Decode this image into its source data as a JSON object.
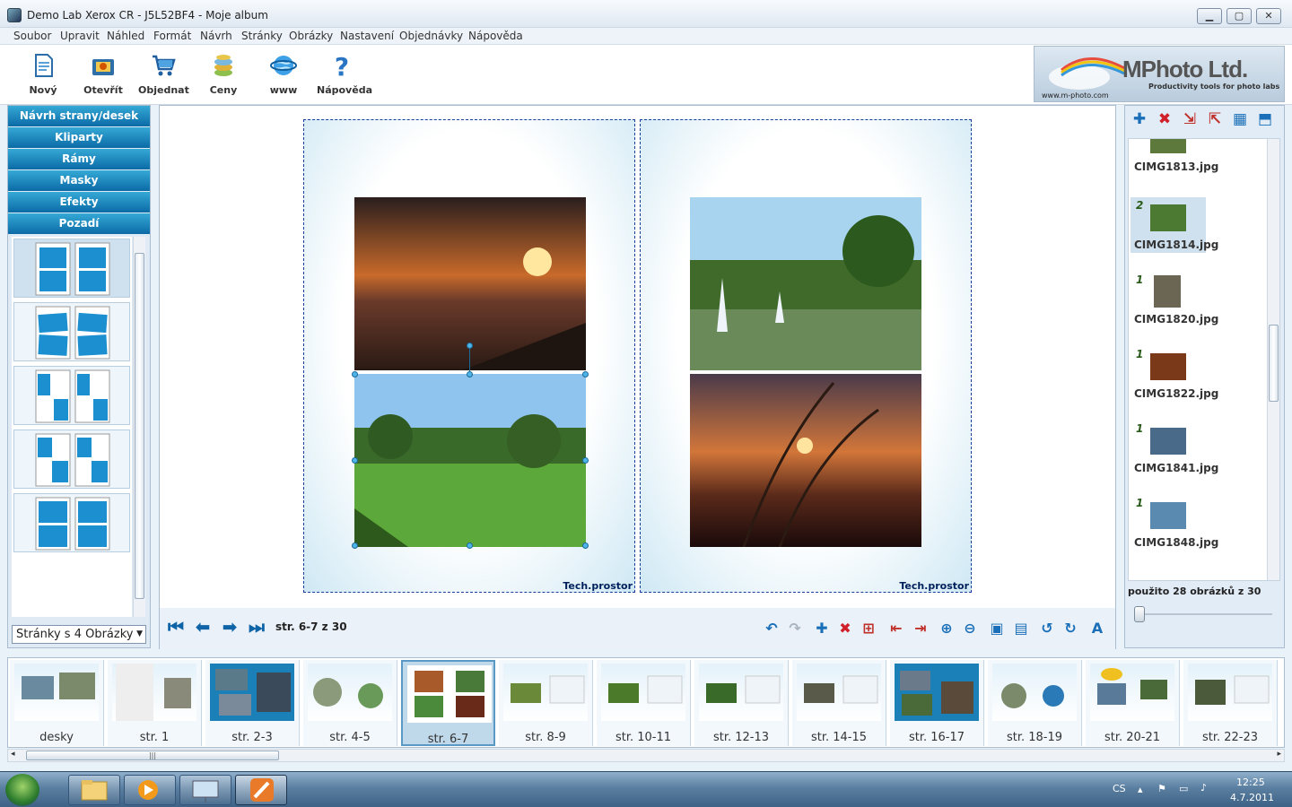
{
  "window": {
    "title": "Demo Lab Xerox CR - J5L52BF4 - Moje album"
  },
  "menu": [
    "Soubor",
    "Upravit",
    "Náhled",
    "Formát",
    "Návrh",
    "Stránky",
    "Obrázky",
    "Nastavení",
    "Objednávky",
    "Nápověda"
  ],
  "toolbar": [
    {
      "label": "Nový",
      "icon": "new-document-icon"
    },
    {
      "label": "Otevřít",
      "icon": "open-icon"
    },
    {
      "label": "Objednat",
      "icon": "cart-icon"
    },
    {
      "label": "Ceny",
      "icon": "coins-icon"
    },
    {
      "label": "www",
      "icon": "globe-icon"
    },
    {
      "label": "Nápověda",
      "icon": "help-icon"
    }
  ],
  "logo": {
    "title": "MPhoto Ltd.",
    "subtitle": "Productivity tools for photo labs",
    "url": "www.m-photo.com"
  },
  "left_panel": {
    "buttons": [
      "Návrh strany/desek",
      "Kliparty",
      "Rámy",
      "Masky",
      "Efekty",
      "Pozadí"
    ],
    "layout_select": "Stránky s 4 Obrázky"
  },
  "editor": {
    "tech_label": "Tech.prostor",
    "page_label": "str. 6-7 z 30"
  },
  "right_panel": {
    "files": [
      {
        "number": "",
        "name": "CIMG1813.jpg",
        "thumb": "#5d7a3c"
      },
      {
        "number": "2",
        "name": "CIMG1814.jpg",
        "thumb": "#4d7a32",
        "selected": true
      },
      {
        "number": "1",
        "name": "CIMG1820.jpg",
        "thumb": "#6b6553"
      },
      {
        "number": "1",
        "name": "CIMG1822.jpg",
        "thumb": "#7a3a1a"
      },
      {
        "number": "1",
        "name": "CIMG1841.jpg",
        "thumb": "#4a6a8a"
      },
      {
        "number": "1",
        "name": "CIMG1848.jpg",
        "thumb": "#5a8ab0"
      }
    ],
    "used_text": "použito 28 obrázků z  30"
  },
  "filmstrip": [
    "desky",
    "str. 1",
    "str. 2-3",
    "str. 4-5",
    "str. 6-7",
    "str. 8-9",
    "str. 10-11",
    "str. 12-13",
    "str. 14-15",
    "str. 16-17",
    "str. 18-19",
    "str. 20-21",
    "str. 22-23"
  ],
  "filmstrip_selected": "str. 6-7",
  "taskbar": {
    "lang": "CS",
    "time": "12:25",
    "date": "4.7.2011"
  },
  "colors": {
    "accent": "#0b6aa6",
    "page_border": "#1a3c9c",
    "tech_text": "#00205b"
  }
}
